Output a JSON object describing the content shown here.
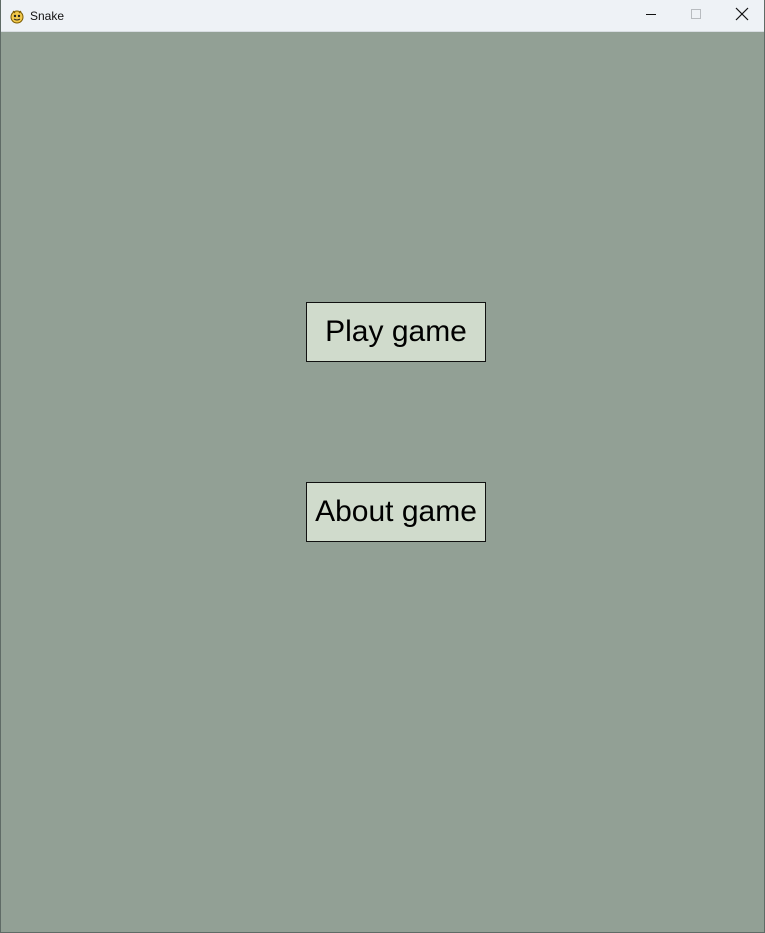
{
  "window": {
    "title": "Snake",
    "controls": {
      "minimize_icon": "minimize-icon",
      "maximize_icon": "maximize-icon",
      "close_icon": "close-icon"
    }
  },
  "menu": {
    "play_label": "Play game",
    "about_label": "About game"
  },
  "colors": {
    "background": "#92a095",
    "button_fill": "#d0dbcc",
    "button_border": "#111111",
    "titlebar": "#eef2f6"
  }
}
